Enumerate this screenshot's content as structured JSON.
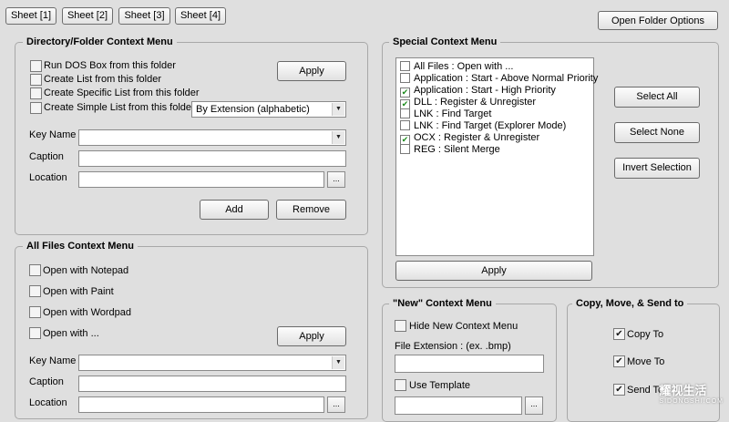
{
  "tabs": [
    "Sheet [1]",
    "Sheet [2]",
    "Sheet [3]",
    "Sheet [4]"
  ],
  "open_folder_options": "Open Folder Options",
  "directory_menu": {
    "title": "Directory/Folder Context Menu",
    "options": [
      {
        "label": "Run DOS Box from this folder",
        "checked": false
      },
      {
        "label": "Create List from this folder",
        "checked": false
      },
      {
        "label": "Create Specific List from this folder",
        "checked": false
      },
      {
        "label": "Create Simple List from this folder",
        "checked": false
      }
    ],
    "apply": "Apply",
    "sort_select": "By Extension (alphabetic)",
    "key_name_label": "Key Name",
    "caption_label": "Caption",
    "location_label": "Location",
    "key_name_value": "",
    "caption_value": "",
    "location_value": "",
    "browse": "...",
    "add": "Add",
    "remove": "Remove"
  },
  "all_files_menu": {
    "title": "All Files Context Menu",
    "options": [
      {
        "label": "Open with Notepad",
        "checked": false
      },
      {
        "label": "Open with Paint",
        "checked": false
      },
      {
        "label": "Open with Wordpad",
        "checked": false
      },
      {
        "label": "Open with ...",
        "checked": false
      }
    ],
    "apply": "Apply",
    "key_name_label": "Key Name",
    "caption_label": "Caption",
    "location_label": "Location",
    "browse": "..."
  },
  "special_menu": {
    "title": "Special Context Menu",
    "items": [
      {
        "label": "All Files : Open with ...",
        "checked": false
      },
      {
        "label": "Application : Start - Above Normal Priority",
        "checked": false
      },
      {
        "label": "Application : Start - High Priority",
        "checked": true
      },
      {
        "label": "DLL : Register & Unregister",
        "checked": true
      },
      {
        "label": "LNK : Find Target",
        "checked": false
      },
      {
        "label": "LNK : Find Target (Explorer Mode)",
        "checked": false
      },
      {
        "label": "OCX : Register & Unregister",
        "checked": true
      },
      {
        "label": "REG : Silent Merge",
        "checked": false
      }
    ],
    "select_all": "Select All",
    "select_none": "Select None",
    "invert_selection": "Invert Selection",
    "apply": "Apply"
  },
  "new_menu": {
    "title": "\"New\" Context Menu",
    "hide_label": "Hide New Context Menu",
    "hide_checked": false,
    "extension_label": "File Extension : (ex. .bmp)",
    "extension_value": "",
    "use_template_label": "Use Template",
    "use_template_checked": false,
    "browse": "..."
  },
  "copy_menu": {
    "title": "Copy, Move, & Send to",
    "items": [
      {
        "label": "Copy To",
        "checked": true
      },
      {
        "label": "Move To",
        "checked": true
      },
      {
        "label": "Send To",
        "checked": true
      }
    ]
  },
  "watermark": {
    "text": "耀视生活",
    "sub": "SIDONGSHI.COM"
  },
  "icons": {
    "check": "check-icon",
    "dropdown": "chevron-down-icon",
    "browse": "ellipsis-icon"
  }
}
